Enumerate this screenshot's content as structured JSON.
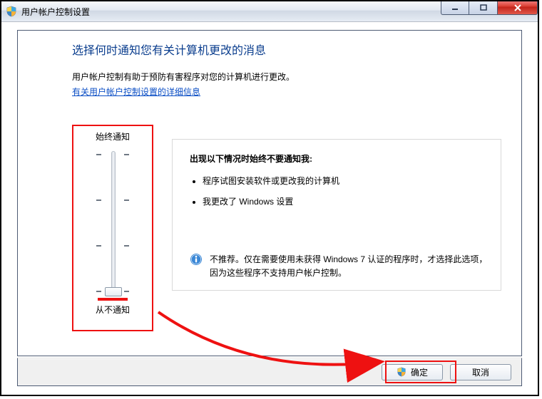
{
  "titlebar": {
    "title": "用户帐户控制设置"
  },
  "heading": "选择何时通知您有关计算机更改的消息",
  "description": "用户帐户控制有助于预防有害程序对您的计算机进行更改。",
  "help_link": "有关用户帐户控制设置的详细信息",
  "slider": {
    "top_label": "始终通知",
    "bottom_label": "从不通知",
    "levels": 4,
    "current_level": 0
  },
  "detail": {
    "subheading": "出现以下情况时始终不要通知我:",
    "bullets": [
      "程序试图安装软件或更改我的计算机",
      "我更改了 Windows 设置"
    ],
    "info": "不推荐。仅在需要使用未获得 Windows 7 认证的程序时，才选择此选项，因为这些程序不支持用户帐户控制。"
  },
  "buttons": {
    "ok": "确定",
    "cancel": "取消"
  }
}
